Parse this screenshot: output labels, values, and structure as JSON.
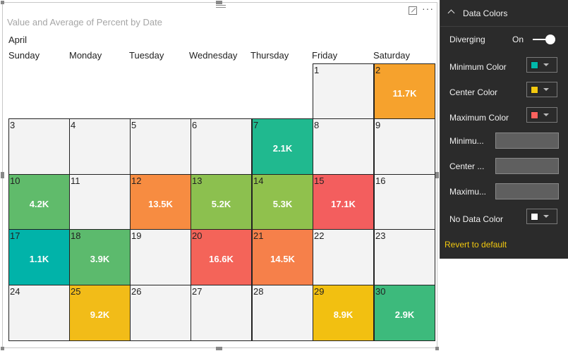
{
  "visual": {
    "title": "Value and Average of Percent by Date",
    "month": "April",
    "days": [
      "Sunday",
      "Monday",
      "Tuesday",
      "Wednesday",
      "Thursday",
      "Friday",
      "Saturday"
    ],
    "focus_icon": "focus-mode-icon",
    "more_icon": "more-options-icon",
    "more_glyph": "···"
  },
  "calendar": [
    {
      "day": "1",
      "value": "",
      "color": "#f3f3f3"
    },
    {
      "day": "2",
      "value": "11.7K",
      "color": "#f6a22d"
    },
    {
      "day": "3",
      "value": "",
      "color": "#f3f3f3"
    },
    {
      "day": "4",
      "value": "",
      "color": "#f3f3f3"
    },
    {
      "day": "5",
      "value": "",
      "color": "#f3f3f3"
    },
    {
      "day": "6",
      "value": "",
      "color": "#f3f3f3"
    },
    {
      "day": "7",
      "value": "2.1K",
      "color": "#20b98f"
    },
    {
      "day": "8",
      "value": "",
      "color": "#f3f3f3"
    },
    {
      "day": "9",
      "value": "",
      "color": "#f3f3f3"
    },
    {
      "day": "10",
      "value": "4.2K",
      "color": "#60bb6b"
    },
    {
      "day": "11",
      "value": "",
      "color": "#f3f3f3"
    },
    {
      "day": "12",
      "value": "13.5K",
      "color": "#f78c41"
    },
    {
      "day": "13",
      "value": "5.2K",
      "color": "#8cc04f"
    },
    {
      "day": "14",
      "value": "5.3K",
      "color": "#90c14d"
    },
    {
      "day": "15",
      "value": "17.1K",
      "color": "#f35e5e"
    },
    {
      "day": "16",
      "value": "",
      "color": "#f3f3f3"
    },
    {
      "day": "17",
      "value": "1.1K",
      "color": "#01b3a9"
    },
    {
      "day": "18",
      "value": "3.9K",
      "color": "#5cba6d"
    },
    {
      "day": "19",
      "value": "",
      "color": "#f3f3f3"
    },
    {
      "day": "20",
      "value": "16.6K",
      "color": "#f46459"
    },
    {
      "day": "21",
      "value": "14.5K",
      "color": "#f6804a"
    },
    {
      "day": "22",
      "value": "",
      "color": "#f3f3f3"
    },
    {
      "day": "23",
      "value": "",
      "color": "#f3f3f3"
    },
    {
      "day": "24",
      "value": "",
      "color": "#f3f3f3"
    },
    {
      "day": "25",
      "value": "9.2K",
      "color": "#f2bc18"
    },
    {
      "day": "26",
      "value": "",
      "color": "#f3f3f3"
    },
    {
      "day": "27",
      "value": "",
      "color": "#f3f3f3"
    },
    {
      "day": "28",
      "value": "",
      "color": "#f3f3f3"
    },
    {
      "day": "29",
      "value": "8.9K",
      "color": "#f2c011"
    },
    {
      "day": "30",
      "value": "2.9K",
      "color": "#3dba7c"
    }
  ],
  "format_pane": {
    "section_title": "Data Colors",
    "section_icon": "chevron-up-icon",
    "diverging_label": "Diverging",
    "diverging_state": "On",
    "minimum_color_label": "Minimum Color",
    "minimum_color": "#01b8aa",
    "center_color_label": "Center Color",
    "center_color": "#f2c80f",
    "maximum_color_label": "Maximum Color",
    "maximum_color": "#fd625e",
    "minimum_value_label": "Minimu...",
    "minimum_value": "",
    "center_value_label": "Center ...",
    "center_value": "",
    "maximum_value_label": "Maximu...",
    "maximum_value": "",
    "no_data_color_label": "No Data Color",
    "no_data_color": "#ffffff",
    "revert_label": "Revert to default"
  }
}
